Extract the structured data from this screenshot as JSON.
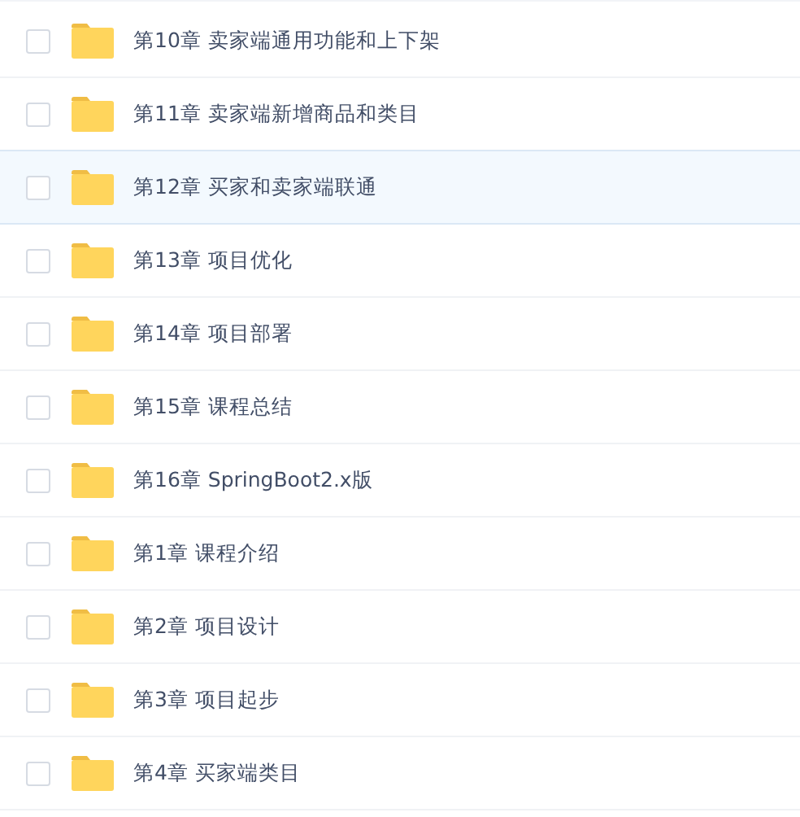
{
  "files": [
    {
      "name": "第10章 卖家端通用功能和上下架",
      "checked": false,
      "selected": false
    },
    {
      "name": "第11章 卖家端新增商品和类目",
      "checked": false,
      "selected": false
    },
    {
      "name": "第12章 买家和卖家端联通",
      "checked": false,
      "selected": true
    },
    {
      "name": "第13章 项目优化",
      "checked": false,
      "selected": false
    },
    {
      "name": "第14章 项目部署",
      "checked": false,
      "selected": false
    },
    {
      "name": "第15章 课程总结",
      "checked": false,
      "selected": false
    },
    {
      "name": "第16章 SpringBoot2.x版",
      "checked": false,
      "selected": false
    },
    {
      "name": "第1章 课程介绍",
      "checked": false,
      "selected": false
    },
    {
      "name": "第2章 项目设计",
      "checked": false,
      "selected": false
    },
    {
      "name": "第3章 项目起步",
      "checked": false,
      "selected": false
    },
    {
      "name": "第4章 买家端类目",
      "checked": false,
      "selected": false
    }
  ]
}
